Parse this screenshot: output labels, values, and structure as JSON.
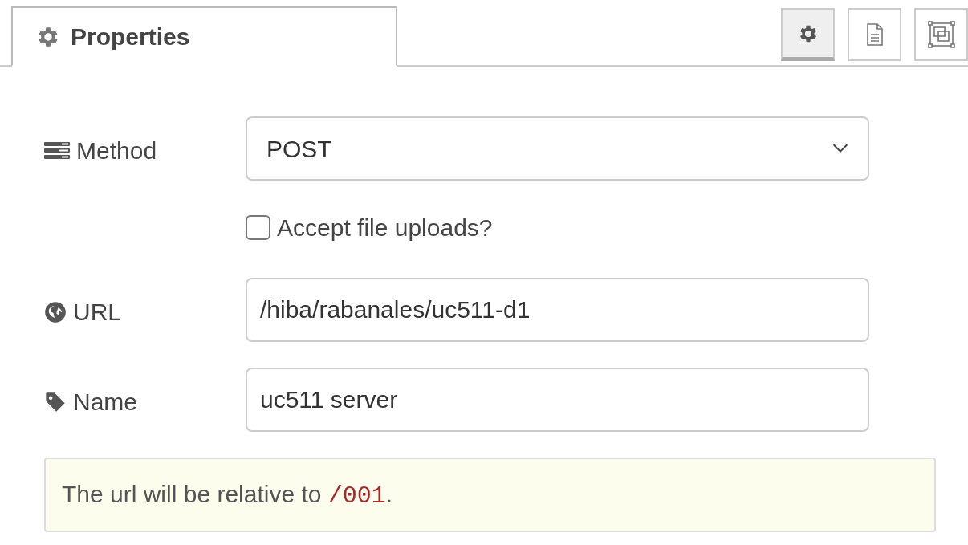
{
  "tabs": [
    {
      "label": "Properties",
      "selected": true
    }
  ],
  "toolbar": [
    {
      "kind": "settings",
      "selected": true
    },
    {
      "kind": "description",
      "selected": false
    },
    {
      "kind": "appearance",
      "selected": false
    }
  ],
  "fields": [
    {
      "kind": "select",
      "label": "Method",
      "value": "POST"
    },
    {
      "kind": "checkbox",
      "label": "Accept file uploads?",
      "checked": false
    },
    {
      "kind": "text",
      "label": "URL",
      "value": "/hiba/rabanales/uc511-d1"
    },
    {
      "kind": "text",
      "label": "Name",
      "value": "uc511 server"
    }
  ],
  "tip": {
    "text": "The url will be relative to ",
    "code": "/001",
    "suffix": "."
  }
}
